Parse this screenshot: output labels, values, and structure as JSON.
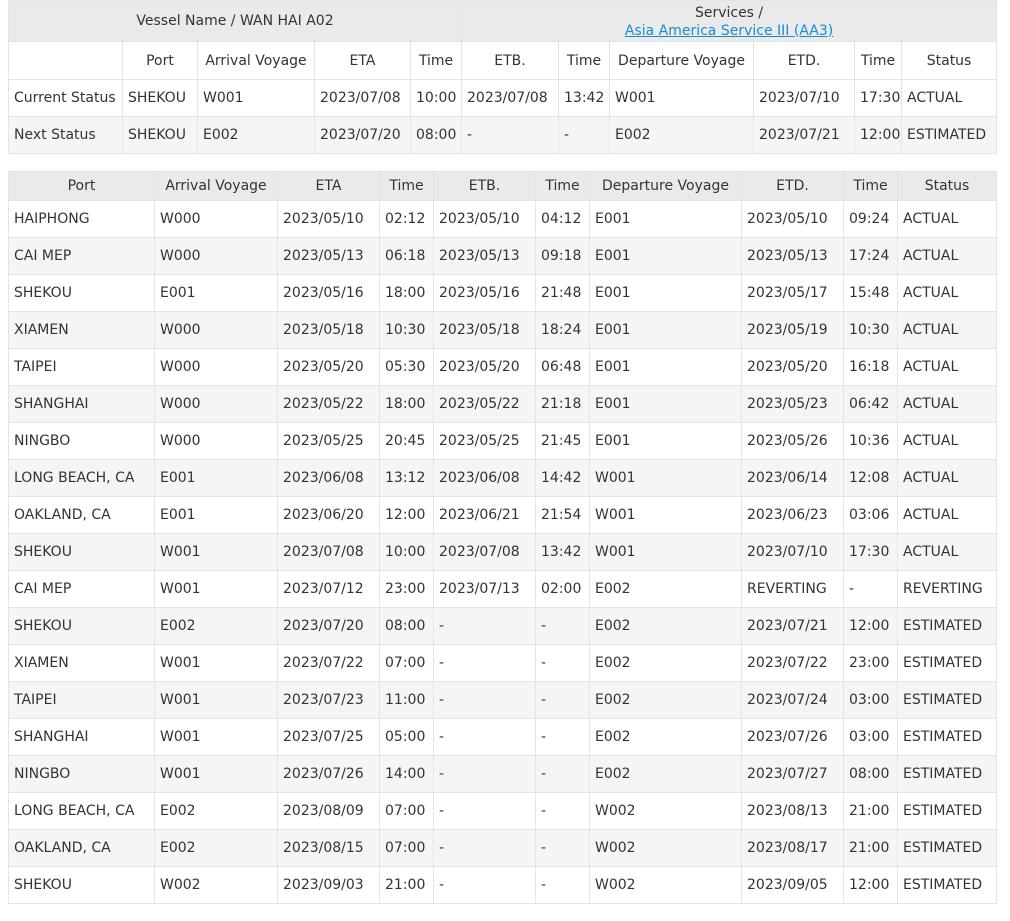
{
  "header": {
    "vessel_label": "Vessel Name / WAN HAI A02",
    "services_label": "Services /",
    "service_link": "Asia America Service III (AA3)"
  },
  "columns": {
    "port": "Port",
    "arrival_voyage": "Arrival Voyage",
    "eta": "ETA",
    "time": "Time",
    "etb": "ETB.",
    "departure_voyage": "Departure Voyage",
    "etd": "ETD.",
    "status": "Status"
  },
  "current_rows": [
    [
      "Current Status",
      "SHEKOU",
      "W001",
      "2023/07/08",
      "10:00",
      "2023/07/08",
      "13:42",
      "W001",
      "2023/07/10",
      "17:30",
      "ACTUAL"
    ],
    [
      "Next Status",
      "SHEKOU",
      "E002",
      "2023/07/20",
      "08:00",
      "-",
      "-",
      "E002",
      "2023/07/21",
      "12:00",
      "ESTIMATED"
    ]
  ],
  "schedule_rows": [
    [
      "HAIPHONG",
      "W000",
      "2023/05/10",
      "02:12",
      "2023/05/10",
      "04:12",
      "E001",
      "2023/05/10",
      "09:24",
      "ACTUAL"
    ],
    [
      "CAI MEP",
      "W000",
      "2023/05/13",
      "06:18",
      "2023/05/13",
      "09:18",
      "E001",
      "2023/05/13",
      "17:24",
      "ACTUAL"
    ],
    [
      "SHEKOU",
      "E001",
      "2023/05/16",
      "18:00",
      "2023/05/16",
      "21:48",
      "E001",
      "2023/05/17",
      "15:48",
      "ACTUAL"
    ],
    [
      "XIAMEN",
      "W000",
      "2023/05/18",
      "10:30",
      "2023/05/18",
      "18:24",
      "E001",
      "2023/05/19",
      "10:30",
      "ACTUAL"
    ],
    [
      "TAIPEI",
      "W000",
      "2023/05/20",
      "05:30",
      "2023/05/20",
      "06:48",
      "E001",
      "2023/05/20",
      "16:18",
      "ACTUAL"
    ],
    [
      "SHANGHAI",
      "W000",
      "2023/05/22",
      "18:00",
      "2023/05/22",
      "21:18",
      "E001",
      "2023/05/23",
      "06:42",
      "ACTUAL"
    ],
    [
      "NINGBO",
      "W000",
      "2023/05/25",
      "20:45",
      "2023/05/25",
      "21:45",
      "E001",
      "2023/05/26",
      "10:36",
      "ACTUAL"
    ],
    [
      "LONG BEACH, CA",
      "E001",
      "2023/06/08",
      "13:12",
      "2023/06/08",
      "14:42",
      "W001",
      "2023/06/14",
      "12:08",
      "ACTUAL"
    ],
    [
      "OAKLAND, CA",
      "E001",
      "2023/06/20",
      "12:00",
      "2023/06/21",
      "21:54",
      "W001",
      "2023/06/23",
      "03:06",
      "ACTUAL"
    ],
    [
      "SHEKOU",
      "W001",
      "2023/07/08",
      "10:00",
      "2023/07/08",
      "13:42",
      "W001",
      "2023/07/10",
      "17:30",
      "ACTUAL"
    ],
    [
      "CAI MEP",
      "W001",
      "2023/07/12",
      "23:00",
      "2023/07/13",
      "02:00",
      "E002",
      "REVERTING",
      "-",
      "REVERTING"
    ],
    [
      "SHEKOU",
      "E002",
      "2023/07/20",
      "08:00",
      "-",
      "-",
      "E002",
      "2023/07/21",
      "12:00",
      "ESTIMATED"
    ],
    [
      "XIAMEN",
      "W001",
      "2023/07/22",
      "07:00",
      "-",
      "-",
      "E002",
      "2023/07/22",
      "23:00",
      "ESTIMATED"
    ],
    [
      "TAIPEI",
      "W001",
      "2023/07/23",
      "11:00",
      "-",
      "-",
      "E002",
      "2023/07/24",
      "03:00",
      "ESTIMATED"
    ],
    [
      "SHANGHAI",
      "W001",
      "2023/07/25",
      "05:00",
      "-",
      "-",
      "E002",
      "2023/07/26",
      "03:00",
      "ESTIMATED"
    ],
    [
      "NINGBO",
      "W001",
      "2023/07/26",
      "14:00",
      "-",
      "-",
      "E002",
      "2023/07/27",
      "08:00",
      "ESTIMATED"
    ],
    [
      "LONG BEACH, CA",
      "E002",
      "2023/08/09",
      "07:00",
      "-",
      "-",
      "W002",
      "2023/08/13",
      "21:00",
      "ESTIMATED"
    ],
    [
      "OAKLAND, CA",
      "E002",
      "2023/08/15",
      "07:00",
      "-",
      "-",
      "W002",
      "2023/08/17",
      "21:00",
      "ESTIMATED"
    ],
    [
      "SHEKOU",
      "W002",
      "2023/09/03",
      "21:00",
      "-",
      "-",
      "W002",
      "2023/09/05",
      "12:00",
      "ESTIMATED"
    ]
  ]
}
